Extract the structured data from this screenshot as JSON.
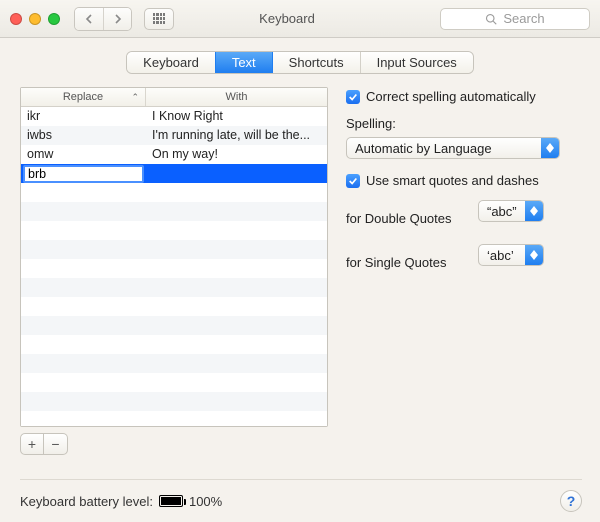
{
  "titlebar": {
    "title": "Keyboard",
    "search_placeholder": "Search"
  },
  "tabs": {
    "keyboard": "Keyboard",
    "text": "Text",
    "shortcuts": "Shortcuts",
    "input_sources": "Input Sources"
  },
  "table": {
    "header_replace": "Replace",
    "header_with": "With",
    "rows": [
      {
        "replace": "ikr",
        "with": "I Know Right"
      },
      {
        "replace": "iwbs",
        "with": "I'm running late, will be the..."
      },
      {
        "replace": "omw",
        "with": "On my way!"
      }
    ],
    "editing_row": {
      "replace": "brb",
      "with": ""
    }
  },
  "buttons": {
    "add_symbol": "+",
    "remove_symbol": "−"
  },
  "right": {
    "correct_spelling": "Correct spelling automatically",
    "spelling_label": "Spelling:",
    "spelling_value": "Automatic by Language",
    "smart_quotes": "Use smart quotes and dashes",
    "double_label": "for Double Quotes",
    "double_value": "“abc”",
    "single_label": "for Single Quotes",
    "single_value": "‘abc’"
  },
  "bottom": {
    "battery_label": "Keyboard battery level:",
    "battery_percent": "100%"
  },
  "help_symbol": "?"
}
